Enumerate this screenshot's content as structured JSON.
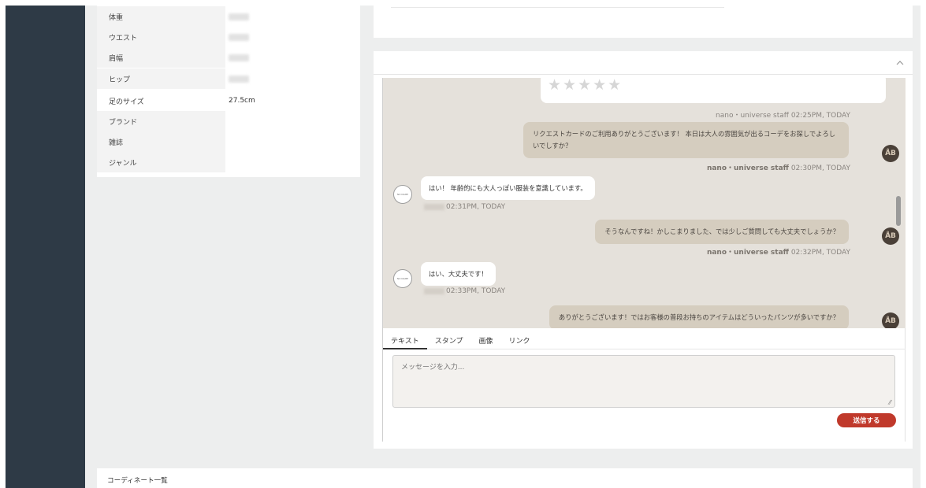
{
  "profile": {
    "rows": [
      {
        "label": "体重",
        "value": ""
      },
      {
        "label": "ウエスト",
        "value": ""
      },
      {
        "label": "肩幅",
        "value": ""
      },
      {
        "label": "ヒップ",
        "value": ""
      },
      {
        "label": "足のサイズ",
        "value": "27.5cm"
      },
      {
        "label": "ブランド",
        "value": ""
      },
      {
        "label": "雑誌",
        "value": ""
      },
      {
        "label": "ジャンル",
        "value": ""
      }
    ]
  },
  "chat": {
    "collapse_icon": "chevron-up-icon",
    "rating_stars": "★★★★★",
    "messages": [
      {
        "from": "meta",
        "text": "nano・universe staff 02:25PM, TODAY"
      },
      {
        "from": "staff",
        "text": "リクエストカードのご利用ありがとうございます！ 本日は大人の雰囲気が出るコーデをお探しでよろしいでしすか？",
        "meta_name": "nano・universe staff",
        "meta_time": "02:30PM, TODAY"
      },
      {
        "from": "user",
        "text": "はい！ 年齢的にも大人っぽい服装を意識しています。",
        "meta_time": "02:31PM, TODAY"
      },
      {
        "from": "staff",
        "text": "そうなんですね！かしこまりました、では少しご質問しても大丈夫でしょうか？",
        "meta_name": "nano・universe staff",
        "meta_time": "02:32PM, TODAY"
      },
      {
        "from": "user",
        "text": "はい、大丈夫です！",
        "meta_time": "02:33PM, TODAY"
      },
      {
        "from": "staff",
        "text": "ありがとうございます！ではお客様の普段お持ちのアイテムはどういったパンツが多いですか？"
      }
    ],
    "staff_avatar_text": "ÅB",
    "user_avatar_text": "NO NAME",
    "tabs": [
      "テキスト",
      "スタンプ",
      "画像",
      "リンク"
    ],
    "input_placeholder": "メッセージを入力...",
    "send_label": "送信する"
  },
  "coordinate": {
    "title": "コーディネート一覧"
  },
  "colors": {
    "sidebar": "#2e3a46",
    "chat_bg": "#e5e1db",
    "staff_bubble": "#d5cdbf",
    "send_button": "#c0392b"
  }
}
